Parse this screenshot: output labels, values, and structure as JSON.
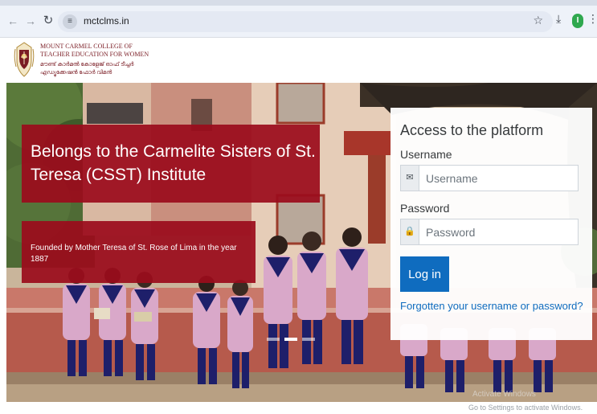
{
  "browser": {
    "url": "mctclms.in",
    "icons": {
      "back": "arrow-left-icon",
      "forward": "arrow-right-icon",
      "reload": "reload-icon",
      "site_info": "tune-icon",
      "bookmark": "star-icon",
      "download": "download-icon",
      "menu": "kebab-menu-icon"
    },
    "profile_initial": "I"
  },
  "header": {
    "college_name_line1": "MOUNT CARMEL COLLEGE OF",
    "college_name_line2": "TEACHER EDUCATION FOR WOMEN",
    "college_name_ml_line1": "മൗണ്ട് കാർമൽ കോളേജ് ഓഫ് ടീച്ചർ",
    "college_name_ml_line2": "എഡ്യൂക്കേഷൻ ഫോർ വിമൻ",
    "logo_icon": "college-crest-icon"
  },
  "hero": {
    "banner_title": "Belongs to the Carmelite Sisters of St. Teresa (CSST) Institute",
    "banner_subtitle": "Founded by Mother Teresa of St. Rose of Lima in the year 1887",
    "carousel_slides": 3,
    "carousel_active_index": 2
  },
  "login": {
    "title": "Access to the platform",
    "username_label": "Username",
    "username_placeholder": "Username",
    "username_icon": "envelope-icon",
    "password_label": "Password",
    "password_placeholder": "Password",
    "password_icon": "lock-icon",
    "submit_label": "Log in",
    "forgot_link": "Forgotten your username or password?"
  },
  "os_overlay": {
    "activate_title": "Activate Windows",
    "activate_note": "Go to Settings to activate Windows."
  },
  "colors": {
    "banner_red": "#9b0c1c",
    "link_blue": "#0f6cbf",
    "uniform_lilac": "#d9a8c9",
    "uniform_navy": "#1e1f6a"
  }
}
